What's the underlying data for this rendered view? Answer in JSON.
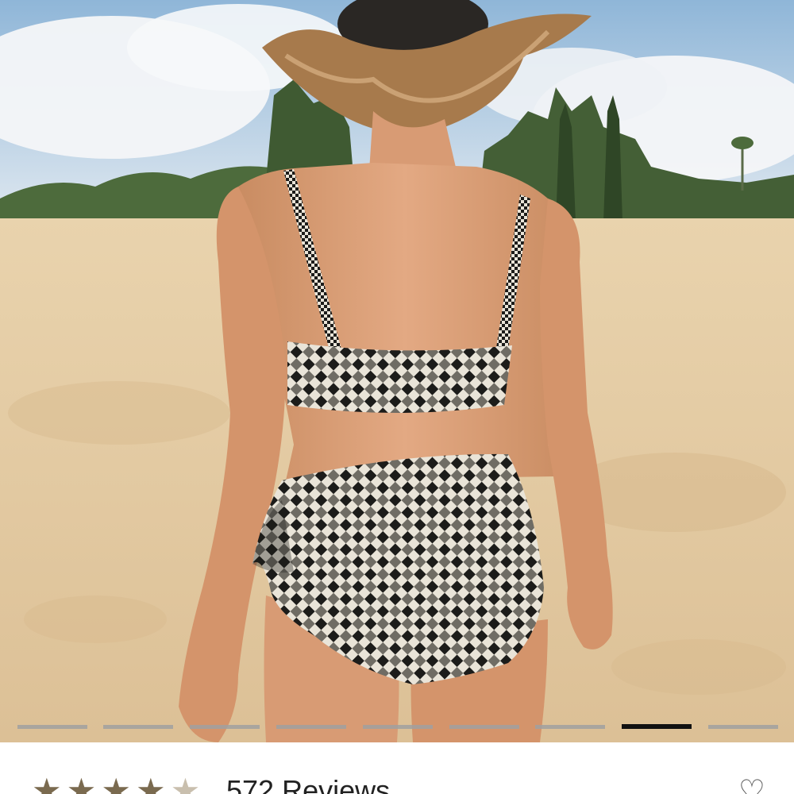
{
  "gallery": {
    "image_alt": "Model on beach wearing black and white gingham bikini, back view",
    "slide_count": 9,
    "active_slide": 8
  },
  "reviews": {
    "rating": 4.5,
    "count_label": "572 Reviews"
  },
  "wishlist": {
    "icon": "heart-outline-icon",
    "glyph": "♡"
  },
  "colors": {
    "star": "#7a6a4f",
    "pager_active": "#111111",
    "pager_inactive": "#a0a0a0"
  }
}
